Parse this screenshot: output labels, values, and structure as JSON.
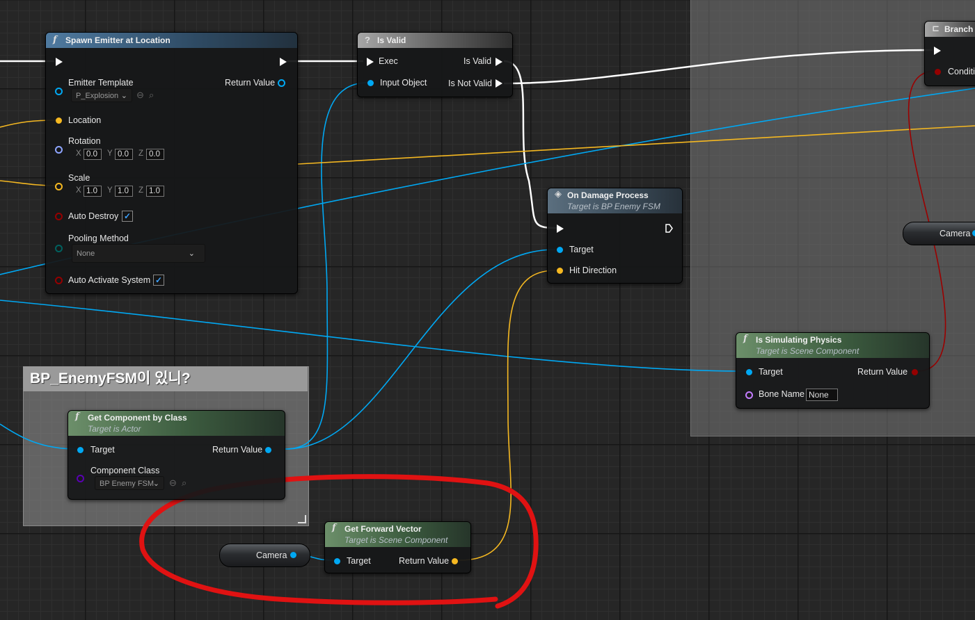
{
  "nodes": {
    "spawn_emitter": {
      "title": "Spawn Emitter at Location",
      "emitter_template_label": "Emitter Template",
      "emitter_template_value": "P_Explosion",
      "return_value_label": "Return Value",
      "location_label": "Location",
      "rotation_label": "Rotation",
      "rotation": {
        "x": "0.0",
        "y": "0.0",
        "z": "0.0"
      },
      "scale_label": "Scale",
      "scale": {
        "x": "1.0",
        "y": "1.0",
        "z": "1.0"
      },
      "auto_destroy_label": "Auto Destroy",
      "pooling_method_label": "Pooling Method",
      "pooling_method_value": "None",
      "auto_activate_label": "Auto Activate System"
    },
    "is_valid": {
      "title": "Is Valid",
      "exec_label": "Exec",
      "is_valid_label": "Is Valid",
      "input_object_label": "Input Object",
      "is_not_valid_label": "Is Not Valid"
    },
    "branch": {
      "title": "Branch",
      "condition_label": "Conditi"
    },
    "on_damage_process": {
      "title": "On Damage Process",
      "subtitle": "Target is BP Enemy FSM",
      "target_label": "Target",
      "hit_direction_label": "Hit Direction"
    },
    "camera_right": {
      "label": "Camera"
    },
    "is_simulating_physics": {
      "title": "Is Simulating Physics",
      "subtitle": "Target is Scene Component",
      "target_label": "Target",
      "return_value_label": "Return Value",
      "bone_name_label": "Bone Name",
      "bone_name_value": "None"
    },
    "get_component_by_class": {
      "title": "Get Component by Class",
      "subtitle": "Target is Actor",
      "target_label": "Target",
      "return_value_label": "Return Value",
      "component_class_label": "Component Class",
      "component_class_value": "BP Enemy FSM"
    },
    "camera_bottom": {
      "label": "Camera"
    },
    "get_forward_vector": {
      "title": "Get Forward Vector",
      "subtitle": "Target is Scene Component",
      "target_label": "Target",
      "return_value_label": "Return Value"
    }
  },
  "comment": {
    "title": "BP_EnemyFSM이 있니?"
  },
  "axis_labels": {
    "x": "X",
    "y": "Y",
    "z": "Z"
  },
  "colors": {
    "exec": "#ffffff",
    "object_pin": "#00a8f3",
    "vector_pin": "#f5b821",
    "bool_pin": "#950000",
    "rotator_pin": "#8ea5ff",
    "name_pin": "#c47cff",
    "class_pin": "#5a00b4",
    "enum_pin": "#00615f",
    "annotation": "#e01212"
  }
}
